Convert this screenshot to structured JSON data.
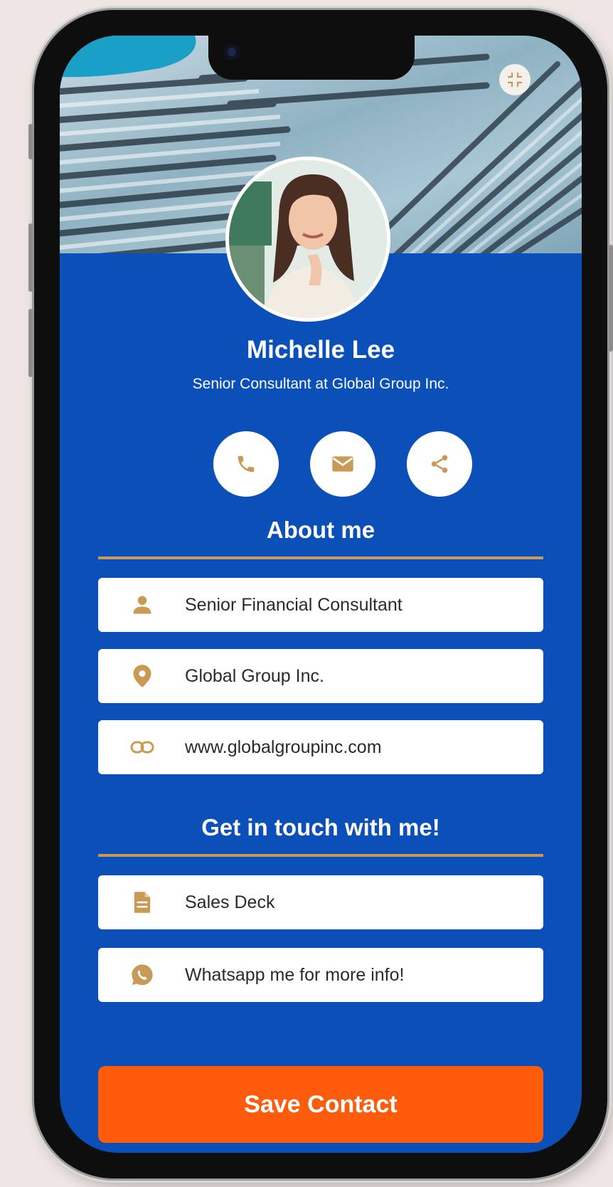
{
  "profile": {
    "name": "Michelle Lee",
    "subtitle": "Senior Consultant at Global Group Inc."
  },
  "actions": [
    {
      "icon": "phone-icon"
    },
    {
      "icon": "mail-icon"
    },
    {
      "icon": "share-icon"
    }
  ],
  "about": {
    "title": "About me",
    "items": [
      {
        "icon": "person-icon",
        "label": "Senior Financial Consultant"
      },
      {
        "icon": "location-pin-icon",
        "label": "Global Group Inc."
      },
      {
        "icon": "link-icon",
        "label": "www.globalgroupinc.com"
      }
    ]
  },
  "contact": {
    "title": "Get in touch with me!",
    "items": [
      {
        "icon": "document-icon",
        "label": "Sales Deck"
      },
      {
        "icon": "whatsapp-icon",
        "label": "Whatsapp me for more info!"
      }
    ]
  },
  "save_button": {
    "label": "Save Contact"
  },
  "colors": {
    "screen_background": "#0a50b8",
    "accent_gold": "#c99a55",
    "save_button": "#fd5c0d",
    "card_background": "#ffffff"
  }
}
